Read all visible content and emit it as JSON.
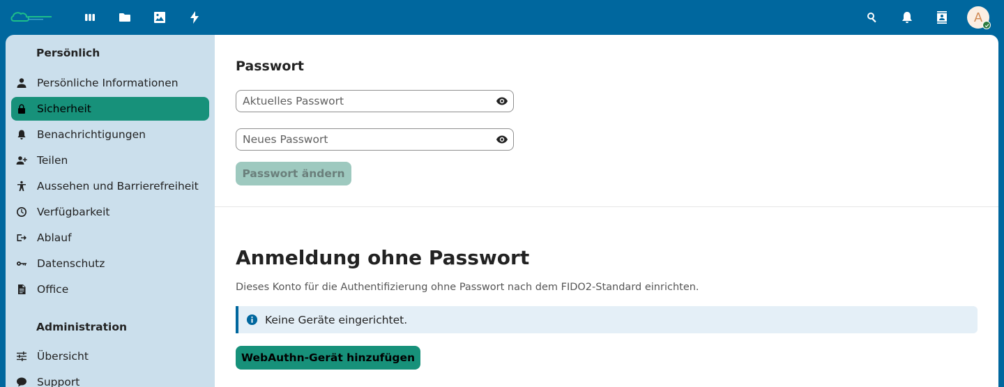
{
  "header": {
    "apps": [
      {
        "name": "dashboard",
        "icon": "dashboard-icon"
      },
      {
        "name": "files",
        "icon": "folder-icon"
      },
      {
        "name": "photos",
        "icon": "image-icon"
      },
      {
        "name": "activity",
        "icon": "bolt-icon"
      }
    ],
    "right_icons": [
      "search-icon",
      "bell-icon",
      "contacts-icon"
    ],
    "avatar_letter": "A"
  },
  "nav": {
    "personal_caption": "Persönlich",
    "personal_items": [
      {
        "label": "Persönliche Informationen",
        "icon": "person-icon"
      },
      {
        "label": "Sicherheit",
        "icon": "lock-icon",
        "active": true
      },
      {
        "label": "Benachrichtigungen",
        "icon": "bell-icon"
      },
      {
        "label": "Teilen",
        "icon": "share-user-icon"
      },
      {
        "label": "Aussehen und Barrierefreiheit",
        "icon": "accessibility-icon"
      },
      {
        "label": "Verfügbarkeit",
        "icon": "clock-icon"
      },
      {
        "label": "Ablauf",
        "icon": "flow-icon"
      },
      {
        "label": "Datenschutz",
        "icon": "key-icon"
      },
      {
        "label": "Office",
        "icon": "document-icon"
      }
    ],
    "admin_caption": "Administration",
    "admin_items": [
      {
        "label": "Übersicht",
        "icon": "sliders-icon"
      },
      {
        "label": "Support",
        "icon": "chat-icon"
      }
    ]
  },
  "password": {
    "title": "Passwort",
    "current_placeholder": "Aktuelles Passwort",
    "new_placeholder": "Neues Passwort",
    "change_button": "Passwort ändern"
  },
  "passwordless": {
    "title": "Anmeldung ohne Passwort",
    "description": "Dieses Konto für die Authentifizierung ohne Passwort nach dem FIDO2-Standard einrichten.",
    "notice": "Keine Geräte eingerichtet.",
    "add_button": "WebAuthn-Gerät hinzufügen"
  },
  "colors": {
    "header_bg": "#00679e",
    "nav_bg": "#cbdfec",
    "accent": "#17917a",
    "notice_bg": "#e4eff7"
  }
}
